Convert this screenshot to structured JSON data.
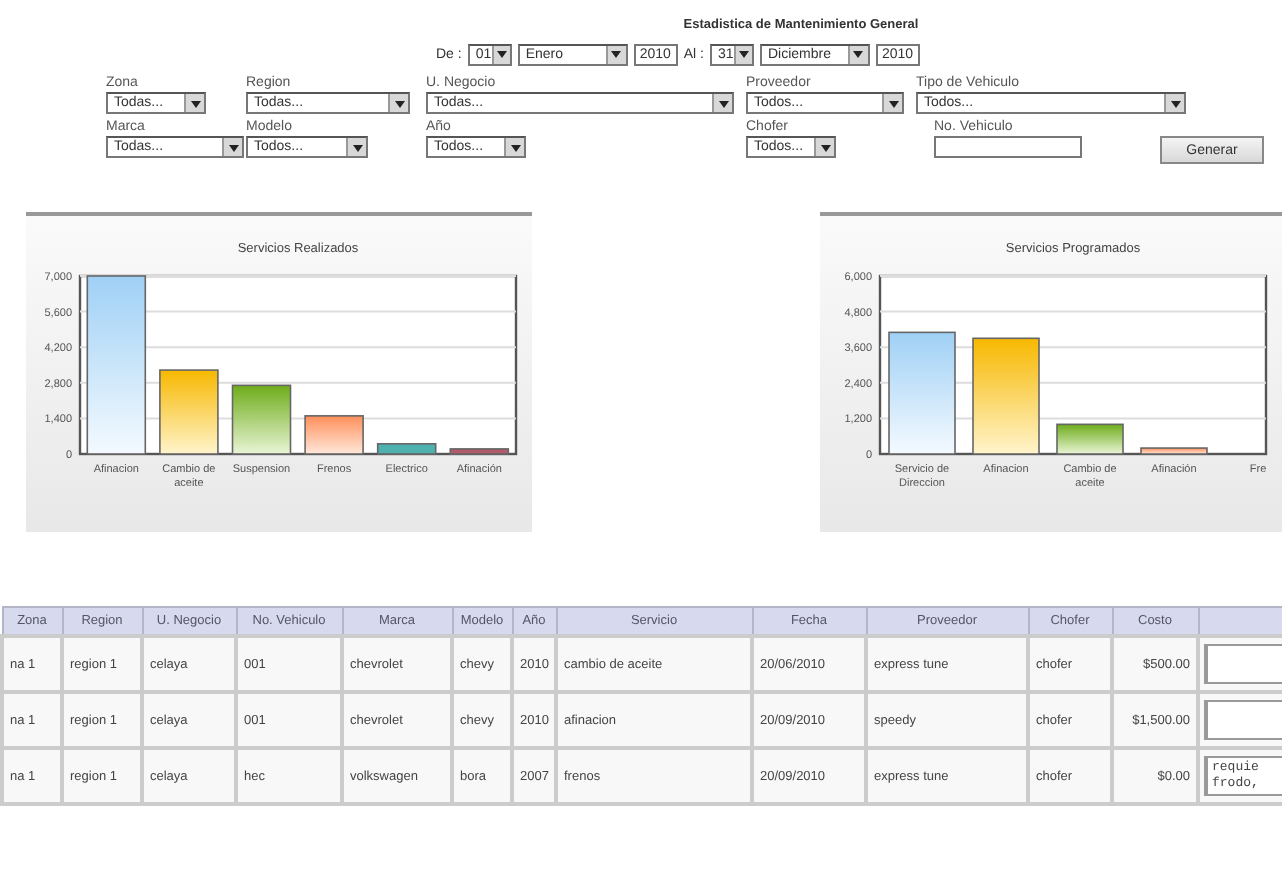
{
  "title": "Estadistica de Mantenimiento General",
  "date_range": {
    "from_label": "De :",
    "from_day": "01",
    "from_month": "Enero",
    "from_year": "2010",
    "to_label": "Al :",
    "to_day": "31",
    "to_month": "Diciembre",
    "to_year": "2010"
  },
  "filters": [
    {
      "label": "Zona",
      "kind": "select",
      "value": "Todas..."
    },
    {
      "label": "Region",
      "kind": "select",
      "value": "Todas..."
    },
    {
      "label": "U. Negocio",
      "kind": "select",
      "value": "Todas..."
    },
    {
      "label": "Proveedor",
      "kind": "select",
      "value": "Todos..."
    },
    {
      "label": "Tipo de Vehiculo",
      "kind": "select",
      "value": "Todos..."
    },
    {
      "label": "Marca",
      "kind": "select",
      "value": "Todas..."
    },
    {
      "label": "Modelo",
      "kind": "select",
      "value": "Todos..."
    },
    {
      "label": "Año",
      "kind": "select",
      "value": "Todos..."
    },
    {
      "label": "Chofer",
      "kind": "select",
      "value": "Todos..."
    },
    {
      "label": "No. Vehiculo",
      "kind": "input"
    }
  ],
  "generate_button": "Generar",
  "charts": [
    {
      "chart_data": {
        "type": "bar",
        "grid": true,
        "title": "Servicios Realizados",
        "categories": [
          "Afinacion",
          "Cambio de aceite",
          "Suspension",
          "Frenos",
          "Electrico",
          "Afinación"
        ],
        "values": [
          7000,
          3300,
          2700,
          1500,
          400,
          200
        ],
        "ylim": [
          0,
          7000
        ],
        "yticks": [
          0,
          {
            "value": 1400,
            "label": "1,400"
          },
          {
            "value": 2800,
            "label": "2,800"
          },
          {
            "value": 4200,
            "label": "4,200"
          },
          {
            "value": 5600,
            "label": "5,600"
          },
          {
            "value": 7000,
            "label": "7,000"
          }
        ]
      }
    },
    {
      "chart_data": {
        "type": "bar",
        "grid": true,
        "title": "Servicios Programados",
        "categories": [
          "Servicio de Direccion",
          "Afinacion",
          "Cambio de aceite",
          "Afinación",
          "Fre"
        ],
        "values": [
          4100,
          3900,
          1000,
          200,
          null
        ],
        "ylim": [
          0,
          6000
        ],
        "yticks": [
          0,
          {
            "value": 1200,
            "label": "1,200"
          },
          {
            "value": 2400,
            "label": "2,400"
          },
          {
            "value": 3600,
            "label": "3,600"
          },
          {
            "value": 4800,
            "label": "4,800"
          },
          {
            "value": 6000,
            "label": "6,000"
          }
        ]
      }
    }
  ],
  "table": {
    "columns": [
      "Zona",
      "Region",
      "U. Negocio",
      "No. Vehiculo",
      "Marca",
      "Modelo",
      "Año",
      "Servicio",
      "Fecha",
      "Proveedor",
      "Chofer",
      "Costo"
    ],
    "rows": [
      {
        "cells": [
          "na 1",
          "region 1",
          "celaya",
          "001",
          "chevrolet",
          "chevy",
          "2010",
          "cambio de aceite",
          "20/06/2010",
          "express tune",
          "chofer",
          "$500.00"
        ],
        "note": ""
      },
      {
        "cells": [
          "na 1",
          "region 1",
          "celaya",
          "001",
          "chevrolet",
          "chevy",
          "2010",
          "afinacion",
          "20/09/2010",
          "speedy",
          "chofer",
          "$1,500.00"
        ],
        "note": ""
      },
      {
        "cells": [
          "na 1",
          "region 1",
          "celaya",
          "hec",
          "volkswagen",
          "bora",
          "2007",
          "frenos",
          "20/09/2010",
          "express tune",
          "chofer",
          "$0.00"
        ],
        "note": "requie\nfrodo,"
      }
    ]
  }
}
